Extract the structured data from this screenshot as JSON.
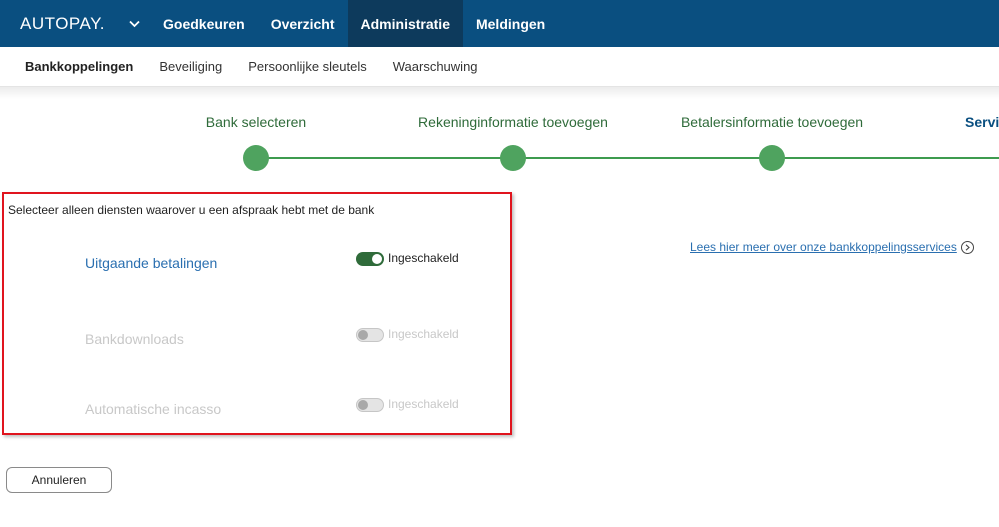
{
  "topnav": {
    "brand": "AUTOPAY.",
    "items": [
      {
        "label": "Goedkeuren",
        "active": false
      },
      {
        "label": "Overzicht",
        "active": false
      },
      {
        "label": "Administratie",
        "active": true
      },
      {
        "label": "Meldingen",
        "active": false
      }
    ]
  },
  "subnav": {
    "items": [
      {
        "label": "Bankkoppelingen",
        "active": true
      },
      {
        "label": "Beveiliging",
        "active": false
      },
      {
        "label": "Persoonlijke sleutels",
        "active": false
      },
      {
        "label": "Waarschuwing",
        "active": false
      }
    ]
  },
  "stepper": {
    "steps": [
      {
        "label": "Bank selecteren"
      },
      {
        "label": "Rekeninginformatie toevoegen"
      },
      {
        "label": "Betalersinformatie toevoegen"
      },
      {
        "label": "Servi"
      }
    ]
  },
  "services": {
    "intro": "Selecteer alleen diensten waarover u een afspraak hebt met de bank",
    "rows": [
      {
        "label": "Uitgaande betalingen",
        "toggle_label": "Ingeschakeld",
        "enabled": true
      },
      {
        "label": "Bankdownloads",
        "toggle_label": "Ingeschakeld",
        "enabled": false
      },
      {
        "label": "Automatische incasso",
        "toggle_label": "Ingeschakeld",
        "enabled": false
      }
    ]
  },
  "info_link": {
    "label": "Lees hier meer over onze bankkoppelingsservices"
  },
  "actions": {
    "cancel_label": "Annuleren"
  },
  "colors": {
    "topbar": "#0a4f80",
    "topbar_active": "#0d3a5c",
    "step_green": "#4fa35f",
    "toggle_on": "#2f6b3a",
    "highlight_border": "#e0141e",
    "link_blue": "#2a6fb0"
  }
}
